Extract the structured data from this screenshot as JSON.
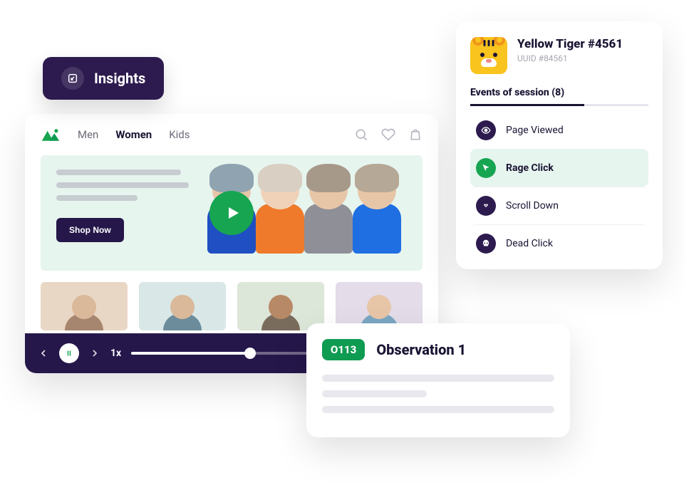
{
  "insights": {
    "label": "Insights"
  },
  "site": {
    "nav": {
      "items": [
        {
          "label": "Men",
          "active": false
        },
        {
          "label": "Women",
          "active": true
        },
        {
          "label": "Kids",
          "active": false
        }
      ]
    },
    "hero": {
      "cta_label": "Shop Now"
    }
  },
  "player": {
    "speed_label": "1x",
    "progress_percent": 45
  },
  "user": {
    "name": "Yellow Tiger #4561",
    "uuid_label": "UUID #84561"
  },
  "events": {
    "title": "Events of session (8)",
    "items": [
      {
        "label": "Page Viewed",
        "icon": "eye-icon",
        "highlight": false
      },
      {
        "label": "Rage Click",
        "icon": "cursor-icon",
        "highlight": true
      },
      {
        "label": "Scroll Down",
        "icon": "scroll-icon",
        "highlight": false
      },
      {
        "label": "Dead Click",
        "icon": "skull-icon",
        "highlight": false
      }
    ]
  },
  "observation": {
    "badge": "O113",
    "title": "Observation 1"
  },
  "colors": {
    "brand_purple": "#25174a",
    "brand_green": "#17a551",
    "accent_yellow": "#f7b500",
    "mint": "#e6f5ee"
  }
}
